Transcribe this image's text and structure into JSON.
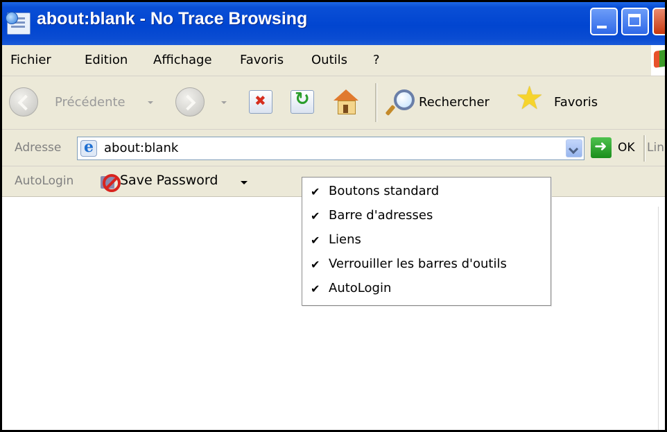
{
  "window": {
    "title": "about:blank - No Trace Browsing",
    "controls": [
      "minimize",
      "maximize",
      "close"
    ]
  },
  "menubar": {
    "items": [
      "Fichier",
      "Edition",
      "Affichage",
      "Favoris",
      "Outils",
      "?"
    ]
  },
  "toolbar": {
    "back_label": "Précédente",
    "search_label": "Rechercher",
    "favorites_label": "Favoris",
    "icons": [
      "back-icon",
      "forward-icon",
      "stop-icon",
      "refresh-icon",
      "home-icon",
      "search-icon",
      "favorites-star-icon"
    ]
  },
  "addressbar": {
    "label": "Adresse",
    "value": "about:blank",
    "go_label": "OK",
    "links_label": "Lin"
  },
  "autologin_bar": {
    "label": "AutoLogin",
    "save_label": "Save Password"
  },
  "context_menu": {
    "items": [
      {
        "label": "Boutons standard",
        "checked": true
      },
      {
        "label": "Barre d'adresses",
        "checked": true
      },
      {
        "label": "Liens",
        "checked": true
      },
      {
        "label": "Verrouiller les barres d'outils",
        "checked": true
      },
      {
        "label": "AutoLogin",
        "checked": true
      }
    ],
    "check_glyph": "✔"
  },
  "colors": {
    "titlebar": "#0145d0",
    "chrome": "#ece9d8",
    "title_text": "#ffffff"
  }
}
